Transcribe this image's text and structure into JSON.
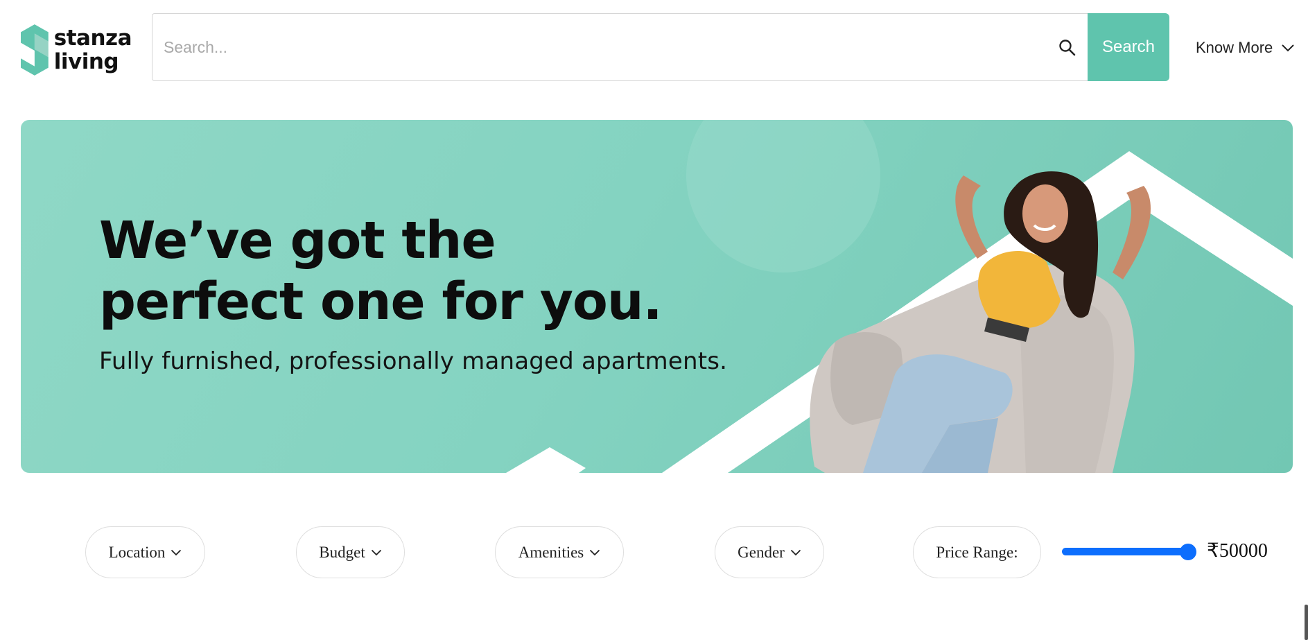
{
  "brand": {
    "line1": "stanza",
    "line2": "living",
    "color": "#5fc4ad"
  },
  "search": {
    "placeholder": "Search...",
    "value": "",
    "button_label": "Search",
    "icon": "search-icon"
  },
  "nav": {
    "know_more_label": "Know More",
    "icon": "chevron-down-icon"
  },
  "banner": {
    "headline_line1": "We’ve got the",
    "headline_line2": "perfect one for you.",
    "subline": "Fully furnished, professionally managed apartments.",
    "bg_color": "#84d3c1"
  },
  "filters": [
    {
      "label": "Location"
    },
    {
      "label": "Budget"
    },
    {
      "label": "Amenities"
    },
    {
      "label": "Gender"
    }
  ],
  "price_range": {
    "label": "Price Range:",
    "value_text": "₹50000",
    "fraction": 1.0,
    "accent": "#0d6efd"
  }
}
